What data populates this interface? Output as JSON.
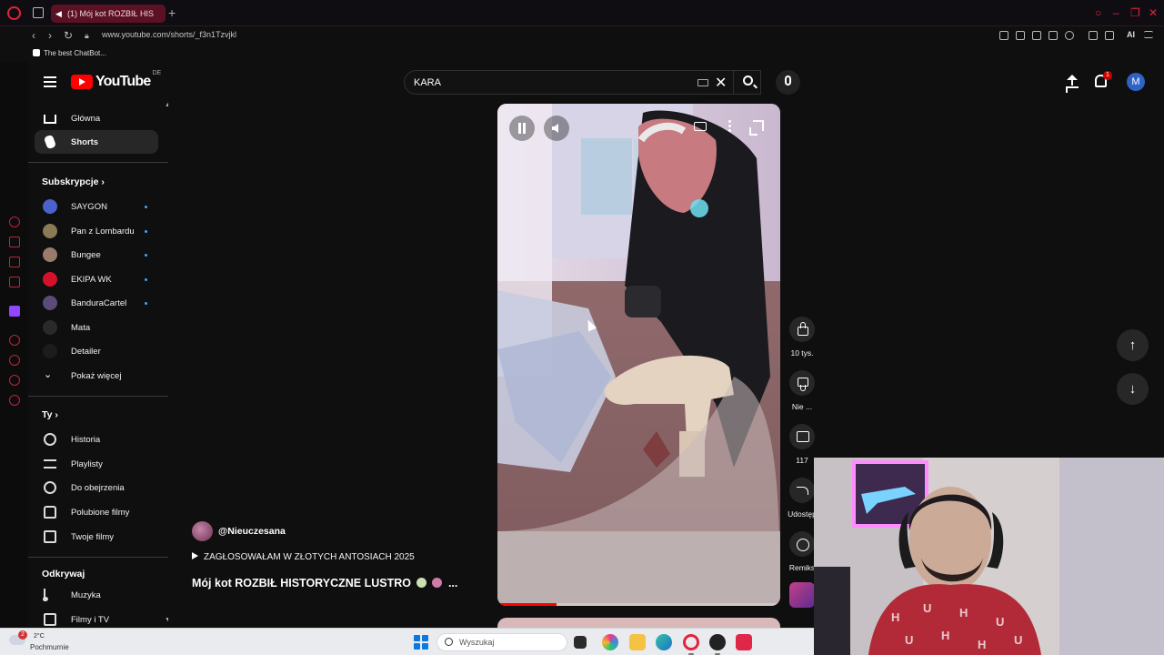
{
  "browser": {
    "tab_title": "(1) Mój kot ROZBIŁ HIS",
    "url": "www.youtube.com/shorts/_f3n1Tzvjkl",
    "bookmark": "The best ChatBot...",
    "ai_label": "AI"
  },
  "header": {
    "logo_text": "YouTube",
    "country_code": "DE",
    "search_value": "KARA",
    "notifications_count": "1",
    "avatar_letter": "M"
  },
  "sidebar": {
    "main": [
      {
        "label": "Główna",
        "icon": "home-icon"
      },
      {
        "label": "Shorts",
        "icon": "shorts-icon",
        "active": true
      }
    ],
    "subscriptions_title": "Subskrypcje",
    "subscriptions": [
      {
        "label": "SAYGON",
        "color": "#4a62c9"
      },
      {
        "label": "Pan z Lombardu",
        "color": "#8a7a55"
      },
      {
        "label": "Bungee",
        "color": "#9a7b6b"
      },
      {
        "label": "EKIPA WK",
        "color": "#d4102a"
      },
      {
        "label": "BanduraCartel",
        "color": "#5b4b7b"
      },
      {
        "label": "Mata",
        "color": "#2a2a2a"
      },
      {
        "label": "Detailer",
        "color": "#1c1c1c"
      }
    ],
    "show_more": "Pokaż więcej",
    "you_title": "Ty",
    "you_items": [
      {
        "label": "Historia",
        "icon": "history-icon"
      },
      {
        "label": "Playlisty",
        "icon": "playlists-icon"
      },
      {
        "label": "Do obejrzenia",
        "icon": "watch-later-icon"
      },
      {
        "label": "Polubione filmy",
        "icon": "liked-icon"
      },
      {
        "label": "Twoje filmy",
        "icon": "your-videos-icon"
      }
    ],
    "explore_title": "Odkrywaj",
    "explore_items": [
      {
        "label": "Muzyka",
        "icon": "music-icon"
      },
      {
        "label": "Filmy i TV",
        "icon": "movies-icon"
      }
    ]
  },
  "short": {
    "channel": "@Nieuczesana",
    "playlist": "ZAGŁOSOWAŁAM W ZŁOTYCH ANTOSIACH 2025",
    "title_start": "Mój kot ROZBIŁ HISTORYCZNE LUSTRO",
    "title_end": "...",
    "progress": 0.21
  },
  "actions": {
    "likes": "10 tys.",
    "dislike": "Nie ...",
    "comments": "117",
    "share": "Udostęp",
    "remix": "Remiks"
  },
  "taskbar": {
    "temperature": "2°C",
    "weather": "Pochmurnie",
    "weather_badge": "2",
    "search_placeholder": "Wyszukaj"
  }
}
